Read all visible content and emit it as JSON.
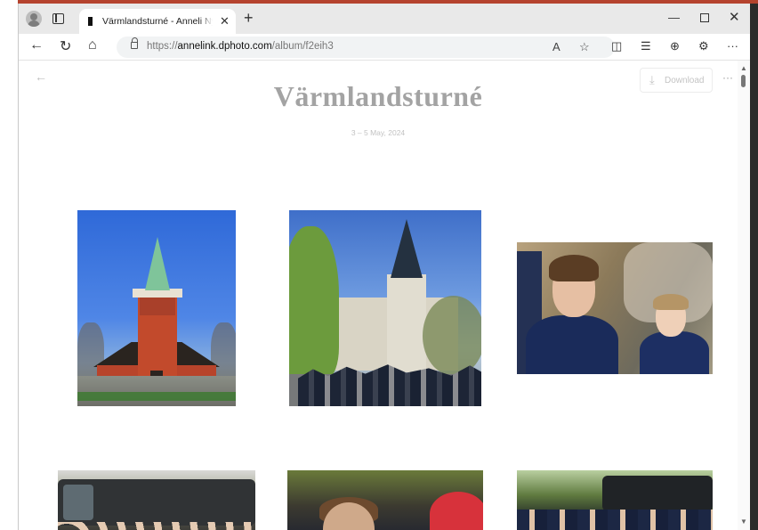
{
  "tab": {
    "title": "Värmlandsturné - Anneli Nygårds"
  },
  "address_bar": {
    "protocol": "https://",
    "domain": "annelink.dphoto.com",
    "path": "/album/f2eih3"
  },
  "page": {
    "album_title": "Värmlandsturné",
    "album_dates": "3 – 5 May, 2024",
    "download_label": "Download"
  },
  "icons": {
    "back": "←",
    "forward": "→",
    "refresh": "↻",
    "home": "⌂",
    "close": "✕",
    "new_tab": "+",
    "minimize": "—",
    "close_window": "✕",
    "read_aloud": "A",
    "favorite": "☆",
    "split": "◫",
    "favorites_bar": "☰",
    "collections": "⊕",
    "extension": "⚙",
    "more": "···",
    "download": "⤓",
    "page_back": "←",
    "page_more": "···",
    "scroll_up": "▲",
    "scroll_down": "▼"
  }
}
